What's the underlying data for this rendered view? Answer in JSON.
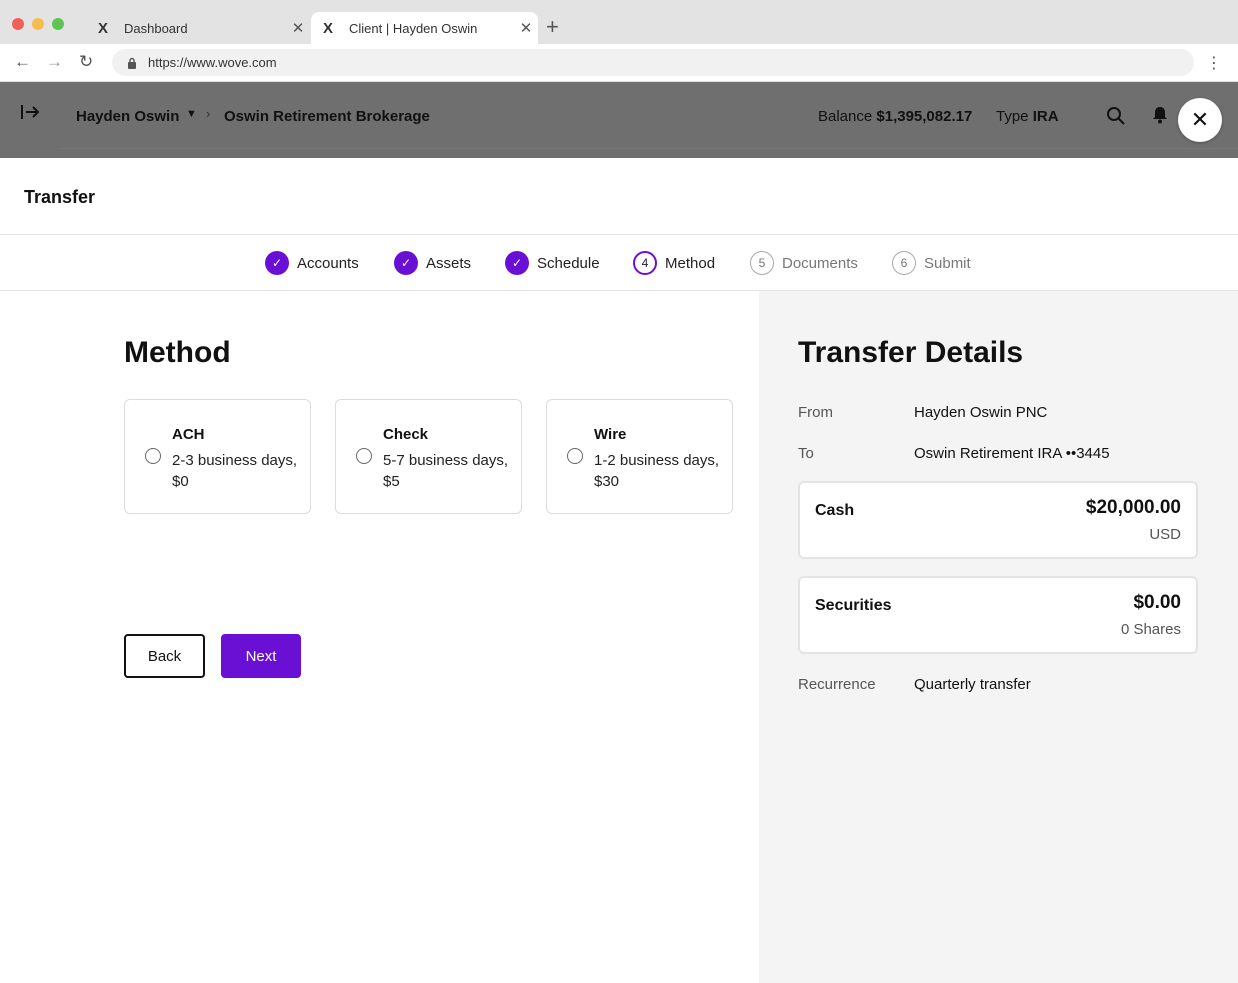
{
  "browser": {
    "tabs": [
      {
        "title": "Dashboard",
        "active": false
      },
      {
        "title": "Client | Hayden Oswin",
        "active": true
      }
    ],
    "url": "https://www.wove.com"
  },
  "header": {
    "client_name": "Hayden Oswin",
    "account_name": "Oswin Retirement Brokerage",
    "balance_label": "Balance",
    "balance_value": "$1,395,082.17",
    "type_label": "Type",
    "type_value": "IRA"
  },
  "modal": {
    "title": "Transfer",
    "steps": [
      {
        "label": "Accounts",
        "number": "1",
        "status": "done"
      },
      {
        "label": "Assets",
        "number": "2",
        "status": "done"
      },
      {
        "label": "Schedule",
        "number": "3",
        "status": "done"
      },
      {
        "label": "Method",
        "number": "4",
        "status": "current"
      },
      {
        "label": "Documents",
        "number": "5",
        "status": "todo"
      },
      {
        "label": "Submit",
        "number": "6",
        "status": "todo"
      }
    ]
  },
  "method": {
    "heading": "Method",
    "options": [
      {
        "title": "ACH",
        "description": "2-3 business days, $0",
        "selected": false
      },
      {
        "title": "Check",
        "description": "5-7 business days, $5",
        "selected": false
      },
      {
        "title": "Wire",
        "description": "1-2 business days, $30",
        "selected": false
      }
    ],
    "back_label": "Back",
    "next_label": "Next"
  },
  "details": {
    "heading": "Transfer Details",
    "from_label": "From",
    "from_value": "Hayden Oswin PNC",
    "to_label": "To",
    "to_value": "Oswin Retirement IRA ••3445",
    "cash": {
      "label": "Cash",
      "amount": "$20,000.00",
      "sub": "USD"
    },
    "securities": {
      "label": "Securities",
      "amount": "$0.00",
      "sub": "0 Shares"
    },
    "recurrence_label": "Recurrence",
    "recurrence_value": "Quarterly transfer"
  },
  "colors": {
    "accent": "#6a10d4"
  }
}
